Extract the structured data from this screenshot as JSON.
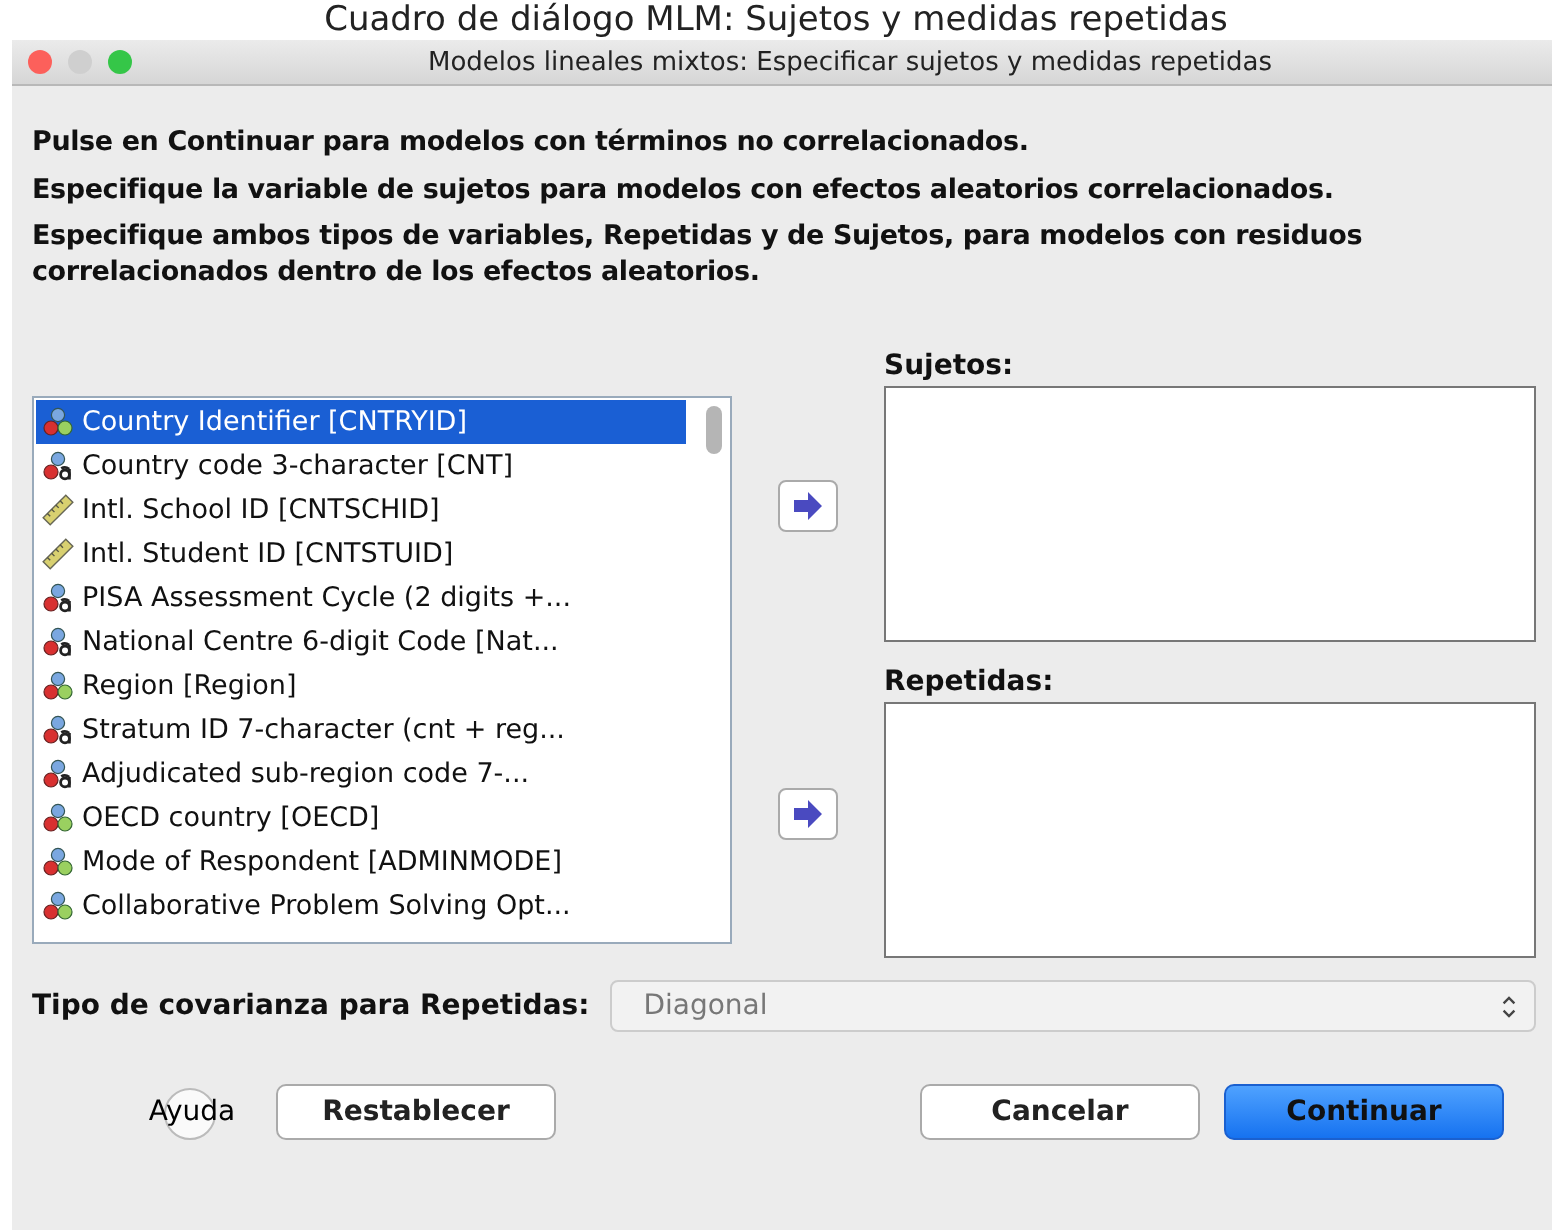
{
  "caption": "Cuadro de diálogo MLM: Sujetos y medidas repetidas",
  "window": {
    "title": "Modelos lineales mixtos: Especificar sujetos y medidas repetidas"
  },
  "instructions": [
    "Pulse en Continuar para modelos con términos no correlacionados.",
    "Especifique la variable de sujetos para modelos con efectos aleatorios correlacionados.",
    "Especifique ambos tipos de variables, Repetidas y de Sujetos, para modelos con residuos correlacionados dentro de los efectos aleatorios."
  ],
  "variables": [
    {
      "label": "Country Identifier [CNTRYID]",
      "kind": "nominal",
      "selected": true
    },
    {
      "label": "Country code 3-character [CNT]",
      "kind": "string",
      "selected": false
    },
    {
      "label": "Intl. School ID [CNTSCHID]",
      "kind": "scale",
      "selected": false
    },
    {
      "label": "Intl. Student ID [CNTSTUID]",
      "kind": "scale",
      "selected": false
    },
    {
      "label": "PISA Assessment Cycle (2 digits +...",
      "kind": "string",
      "selected": false
    },
    {
      "label": "National Centre 6-digit Code [Nat...",
      "kind": "string",
      "selected": false
    },
    {
      "label": "Region [Region]",
      "kind": "nominal",
      "selected": false
    },
    {
      "label": "Stratum ID 7-character (cnt + reg...",
      "kind": "string",
      "selected": false
    },
    {
      "label": "Adjudicated sub-region code 7-...",
      "kind": "string",
      "selected": false
    },
    {
      "label": "OECD country [OECD]",
      "kind": "nominal",
      "selected": false
    },
    {
      "label": "Mode of Respondent [ADMINMODE]",
      "kind": "nominal",
      "selected": false
    },
    {
      "label": "Collaborative Problem Solving Opt...",
      "kind": "nominal",
      "selected": false
    }
  ],
  "targets": [
    {
      "label": "Sujetos:"
    },
    {
      "label": "Repetidas:"
    }
  ],
  "covariance": {
    "label": "Tipo de covarianza para Repetidas:",
    "value": "Diagonal",
    "disabled": true
  },
  "buttons": {
    "help": "Ayuda",
    "reset": "Restablecer",
    "cancel": "Cancelar",
    "ok": "Continuar"
  }
}
